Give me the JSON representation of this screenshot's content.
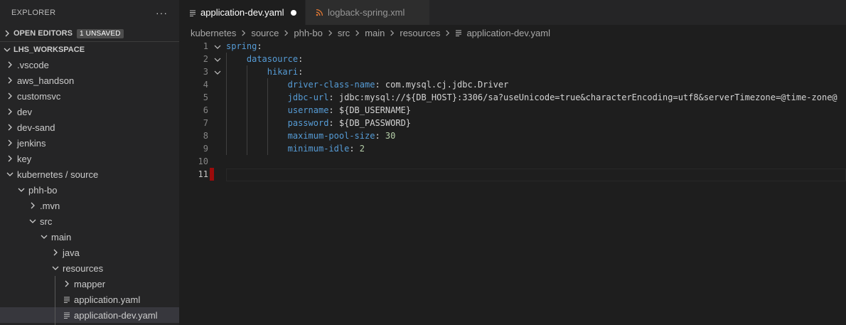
{
  "sidebar": {
    "title": "EXPLORER",
    "more": "···",
    "open_editors": {
      "label": "OPEN EDITORS",
      "badge": "1 UNSAVED"
    },
    "workspace": {
      "label": "LHS_WORKSPACE"
    },
    "tree": [
      {
        "label": ".vscode",
        "kind": "folder",
        "open": false,
        "depth": 0
      },
      {
        "label": "aws_handson",
        "kind": "folder",
        "open": false,
        "depth": 0
      },
      {
        "label": "customsvc",
        "kind": "folder",
        "open": false,
        "depth": 0
      },
      {
        "label": "dev",
        "kind": "folder",
        "open": false,
        "depth": 0
      },
      {
        "label": "dev-sand",
        "kind": "folder",
        "open": false,
        "depth": 0
      },
      {
        "label": "jenkins",
        "kind": "folder",
        "open": false,
        "depth": 0
      },
      {
        "label": "key",
        "kind": "folder",
        "open": false,
        "depth": 0
      },
      {
        "label": "kubernetes / source",
        "kind": "folder",
        "open": true,
        "depth": 0
      },
      {
        "label": "phh-bo",
        "kind": "folder",
        "open": true,
        "depth": 1
      },
      {
        "label": ".mvn",
        "kind": "folder",
        "open": false,
        "depth": 2
      },
      {
        "label": "src",
        "kind": "folder",
        "open": true,
        "depth": 2
      },
      {
        "label": "main",
        "kind": "folder",
        "open": true,
        "depth": 3
      },
      {
        "label": "java",
        "kind": "folder",
        "open": false,
        "depth": 4
      },
      {
        "label": "resources",
        "kind": "folder",
        "open": true,
        "depth": 4
      },
      {
        "label": "mapper",
        "kind": "folder",
        "open": false,
        "depth": 5
      },
      {
        "label": "application.yaml",
        "kind": "file",
        "depth": 5
      },
      {
        "label": "application-dev.yaml",
        "kind": "file",
        "depth": 5,
        "selected": true
      }
    ]
  },
  "tabs": [
    {
      "label": "application-dev.yaml",
      "icon": "lines-icon",
      "active": true,
      "dirty": true
    },
    {
      "label": "logback-spring.xml",
      "icon": "rss-icon",
      "active": false,
      "dirty": false
    }
  ],
  "breadcrumb": [
    "kubernetes",
    "source",
    "phh-bo",
    "src",
    "main",
    "resources",
    "application-dev.yaml"
  ],
  "code": {
    "lines": [
      {
        "num": "1",
        "fold": true,
        "indent": 0,
        "segments": [
          [
            "k",
            "spring"
          ],
          [
            "p",
            ":"
          ]
        ]
      },
      {
        "num": "2",
        "fold": true,
        "indent": 1,
        "segments": [
          [
            "k",
            "datasource"
          ],
          [
            "p",
            ":"
          ]
        ]
      },
      {
        "num": "3",
        "fold": true,
        "indent": 2,
        "segments": [
          [
            "k",
            "hikari"
          ],
          [
            "p",
            ":"
          ]
        ]
      },
      {
        "num": "4",
        "fold": false,
        "indent": 3,
        "segments": [
          [
            "k",
            "driver-class-name"
          ],
          [
            "p",
            ": com.mysql.cj.jdbc.Driver"
          ]
        ]
      },
      {
        "num": "5",
        "fold": false,
        "indent": 3,
        "segments": [
          [
            "k",
            "jdbc-url"
          ],
          [
            "p",
            ": jdbc:mysql://${DB_HOST}:3306/sa?useUnicode=true&characterEncoding=utf8&serverTimezone=@time-zone@"
          ]
        ]
      },
      {
        "num": "6",
        "fold": false,
        "indent": 3,
        "segments": [
          [
            "k",
            "username"
          ],
          [
            "p",
            ": ${DB_USERNAME}"
          ]
        ]
      },
      {
        "num": "7",
        "fold": false,
        "indent": 3,
        "segments": [
          [
            "k",
            "password"
          ],
          [
            "p",
            ": ${DB_PASSWORD}"
          ]
        ]
      },
      {
        "num": "8",
        "fold": false,
        "indent": 3,
        "segments": [
          [
            "k",
            "maximum-pool-size"
          ],
          [
            "p",
            ": "
          ],
          [
            "n",
            "30"
          ]
        ]
      },
      {
        "num": "9",
        "fold": false,
        "indent": 3,
        "segments": [
          [
            "k",
            "minimum-idle"
          ],
          [
            "p",
            ": "
          ],
          [
            "n",
            "2"
          ]
        ]
      },
      {
        "num": "10",
        "fold": false,
        "indent": 0,
        "segments": []
      },
      {
        "num": "11",
        "fold": false,
        "indent": 0,
        "segments": [],
        "current": true,
        "changed": true
      }
    ]
  },
  "colors": {
    "keyword": "#569cd6",
    "number": "#b5cea8",
    "change_marker": "#9b0b0b",
    "selection": "#37373d"
  }
}
